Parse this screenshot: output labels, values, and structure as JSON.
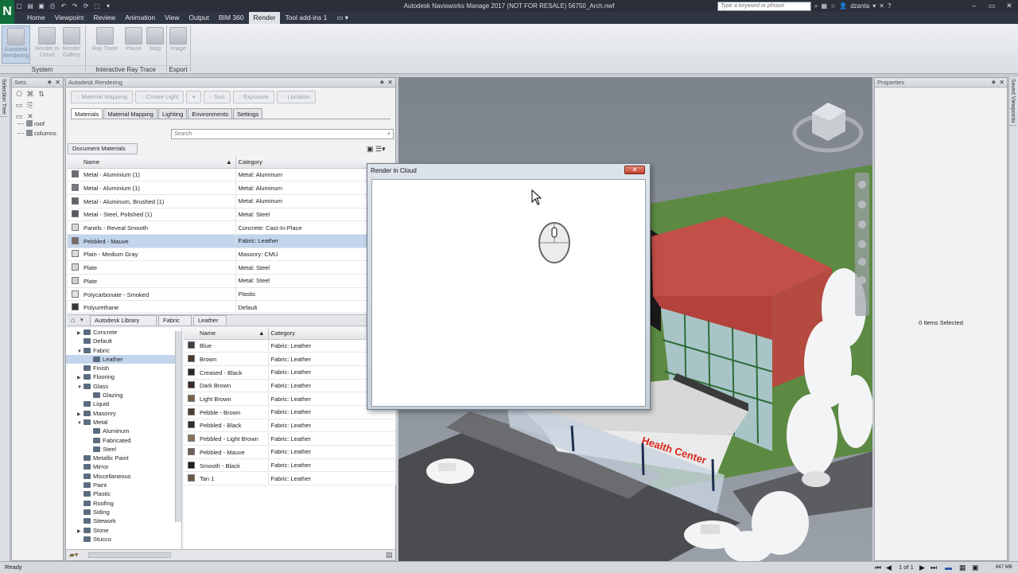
{
  "app": {
    "title": "Autodesk Navisworks Manage 2017 (NOT FOR RESALE)    56750_Arch.nwf",
    "logo_letter": "N",
    "search_placeholder": "Type a keyword or phrase",
    "user": "dzanta"
  },
  "menu_tabs": [
    "Home",
    "Viewpoint",
    "Review",
    "Animation",
    "View",
    "Output",
    "BIM 360",
    "Render",
    "Tool add-ins 1"
  ],
  "active_tab": "Render",
  "ribbon": {
    "buttons": {
      "autodesk_rendering": "Autodesk Rendering",
      "render_in_cloud": "Render in Cloud",
      "render_gallery": "Render Gallery",
      "ray_trace": "Ray Trace",
      "pause": "Pause",
      "stop": "Stop",
      "image": "Image"
    },
    "groups": {
      "system": "System",
      "interactive_ray_trace": "Interactive Ray Trace",
      "export": "Export"
    }
  },
  "side_tabs": {
    "left": "Selection Tree",
    "right": "Saved Viewpoints"
  },
  "sets_panel": {
    "title": "Sets",
    "items": [
      "roof",
      "columns"
    ]
  },
  "render_panel": {
    "title": "Autodesk Rendering",
    "tools": [
      "Material Mapping",
      "Create Light",
      "Sun",
      "Exposure",
      "Location"
    ],
    "tabs": [
      "Materials",
      "Material Mapping",
      "Lighting",
      "Environments",
      "Settings"
    ],
    "active_tab": "Materials",
    "search_placeholder": "Search",
    "doc_materials_label": "Document Materials",
    "columns": {
      "name": "Name",
      "category": "Category"
    },
    "document_materials": [
      {
        "name": "Metal - Aluminium (1)",
        "category": "Metal: Aluminum",
        "swatch": "#6a6d72"
      },
      {
        "name": "Metal - Aluminium (1)",
        "category": "Metal: Aluminum",
        "swatch": "#75787d"
      },
      {
        "name": "Metal - Aluminum, Brushed (1)",
        "category": "Metal: Aluminum",
        "swatch": "#5f6268"
      },
      {
        "name": "Metal - Steel, Polished (1)",
        "category": "Metal: Steel",
        "swatch": "#55585d"
      },
      {
        "name": "Panels - Reveal Smooth",
        "category": "Concrete: Cast-In-Place",
        "swatch": "#d8d8d8"
      },
      {
        "name": "Pebbled - Mauve",
        "category": "Fabric: Leather",
        "swatch": "#7a6a66",
        "selected": true
      },
      {
        "name": "Plain - Medium Gray",
        "category": "Masonry: CMU",
        "swatch": "#dcdcdc"
      },
      {
        "name": "Plate",
        "category": "Metal: Steel",
        "swatch": "#d4d4d4"
      },
      {
        "name": "Plate",
        "category": "Metal: Steel",
        "swatch": "#d0d0d0"
      },
      {
        "name": "Polycarbonate - Smoked",
        "category": "Plastic",
        "swatch": "#e4e4e4"
      },
      {
        "name": "Polyurethane",
        "category": "Default",
        "swatch": "#3a3a3a"
      }
    ],
    "library_breadcrumb": [
      "Autodesk Library",
      "Fabric",
      "Leather"
    ],
    "library_tree": [
      {
        "label": "Concrete",
        "level": 1,
        "arrow": "▶"
      },
      {
        "label": "Default",
        "level": 1,
        "arrow": ""
      },
      {
        "label": "Fabric",
        "level": 1,
        "arrow": "▼"
      },
      {
        "label": "Leather",
        "level": 2,
        "arrow": "",
        "selected": true
      },
      {
        "label": "Finish",
        "level": 1,
        "arrow": ""
      },
      {
        "label": "Flooring",
        "level": 1,
        "arrow": "▶"
      },
      {
        "label": "Glass",
        "level": 1,
        "arrow": "▼"
      },
      {
        "label": "Glazing",
        "level": 2,
        "arrow": ""
      },
      {
        "label": "Liquid",
        "level": 1,
        "arrow": ""
      },
      {
        "label": "Masonry",
        "level": 1,
        "arrow": "▶"
      },
      {
        "label": "Metal",
        "level": 1,
        "arrow": "▼"
      },
      {
        "label": "Aluminum",
        "level": 2,
        "arrow": ""
      },
      {
        "label": "Fabricated",
        "level": 2,
        "arrow": ""
      },
      {
        "label": "Steel",
        "level": 2,
        "arrow": ""
      },
      {
        "label": "Metallic Paint",
        "level": 1,
        "arrow": ""
      },
      {
        "label": "Mirror",
        "level": 1,
        "arrow": ""
      },
      {
        "label": "Miscellaneous",
        "level": 1,
        "arrow": ""
      },
      {
        "label": "Paint",
        "level": 1,
        "arrow": ""
      },
      {
        "label": "Plastic",
        "level": 1,
        "arrow": ""
      },
      {
        "label": "Roofing",
        "level": 1,
        "arrow": ""
      },
      {
        "label": "Siding",
        "level": 1,
        "arrow": ""
      },
      {
        "label": "Sitework",
        "level": 1,
        "arrow": ""
      },
      {
        "label": "Stone",
        "level": 1,
        "arrow": "▶"
      },
      {
        "label": "Stucco",
        "level": 1,
        "arrow": ""
      }
    ],
    "library_materials": [
      {
        "name": "Blue",
        "category": "Fabric: Leather",
        "swatch": "#3c3f48"
      },
      {
        "name": "Brown",
        "category": "Fabric: Leather",
        "swatch": "#4a3a30"
      },
      {
        "name": "Creased - Black",
        "category": "Fabric: Leather",
        "swatch": "#2a2a2a"
      },
      {
        "name": "Dark Brown",
        "category": "Fabric: Leather",
        "swatch": "#3a2c24"
      },
      {
        "name": "Light Brown",
        "category": "Fabric: Leather",
        "swatch": "#7a6248"
      },
      {
        "name": "Pebble - Brown",
        "category": "Fabric: Leather",
        "swatch": "#4e3e32"
      },
      {
        "name": "Pebbled - Black",
        "category": "Fabric: Leather",
        "swatch": "#2e2e2e"
      },
      {
        "name": "Pebbled - Light Brown",
        "category": "Fabric: Leather",
        "swatch": "#8a7258"
      },
      {
        "name": "Pebbled - Mauve",
        "category": "Fabric: Leather",
        "swatch": "#6e5e5a"
      },
      {
        "name": "Smooth - Black",
        "category": "Fabric: Leather",
        "swatch": "#1e1e1e"
      },
      {
        "name": "Tan 1",
        "category": "Fabric: Leather",
        "swatch": "#6a5a48"
      }
    ]
  },
  "properties_panel": {
    "title": "Properties",
    "empty_text": "0 Items Selected"
  },
  "viewport": {
    "sign_text": "Health Center"
  },
  "dialog": {
    "title": "Render in Cloud",
    "close_label": "✕"
  },
  "statusbar": {
    "left": "Ready",
    "page": "1 of 1",
    "memory": "847 MB"
  }
}
